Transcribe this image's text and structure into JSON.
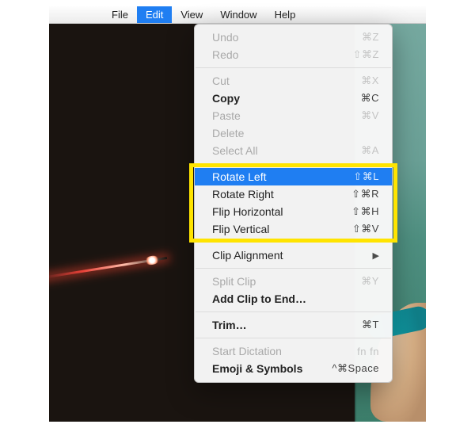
{
  "menubar": {
    "items": [
      {
        "label": "File"
      },
      {
        "label": "Edit"
      },
      {
        "label": "View"
      },
      {
        "label": "Window"
      },
      {
        "label": "Help"
      }
    ],
    "active_index": 1
  },
  "edit_menu": {
    "groups": [
      {
        "items": [
          {
            "label": "Undo",
            "shortcut": "⌘Z",
            "disabled": true
          },
          {
            "label": "Redo",
            "shortcut": "⇧⌘Z",
            "disabled": true
          }
        ]
      },
      {
        "items": [
          {
            "label": "Cut",
            "shortcut": "⌘X",
            "disabled": true
          },
          {
            "label": "Copy",
            "shortcut": "⌘C",
            "bold": true
          },
          {
            "label": "Paste",
            "shortcut": "⌘V",
            "disabled": true
          },
          {
            "label": "Delete",
            "shortcut": "",
            "disabled": true
          },
          {
            "label": "Select All",
            "shortcut": "⌘A",
            "disabled": true
          }
        ]
      },
      {
        "items": [
          {
            "label": "Rotate Left",
            "shortcut": "⇧⌘L",
            "hover": true
          },
          {
            "label": "Rotate Right",
            "shortcut": "⇧⌘R"
          },
          {
            "label": "Flip Horizontal",
            "shortcut": "⇧⌘H"
          },
          {
            "label": "Flip Vertical",
            "shortcut": "⇧⌘V"
          }
        ]
      },
      {
        "items": [
          {
            "label": "Clip Alignment",
            "submenu": true
          }
        ]
      },
      {
        "items": [
          {
            "label": "Split Clip",
            "shortcut": "⌘Y",
            "disabled": true
          },
          {
            "label": "Add Clip to End…",
            "bold": true
          }
        ]
      },
      {
        "items": [
          {
            "label": "Trim…",
            "shortcut": "⌘T",
            "bold": true
          }
        ]
      },
      {
        "items": [
          {
            "label": "Start Dictation",
            "shortcut": "fn fn",
            "disabled": true
          },
          {
            "label": "Emoji & Symbols",
            "shortcut": "^⌘Space",
            "bold": true
          }
        ]
      }
    ]
  },
  "highlight": {
    "group_index": 2
  }
}
